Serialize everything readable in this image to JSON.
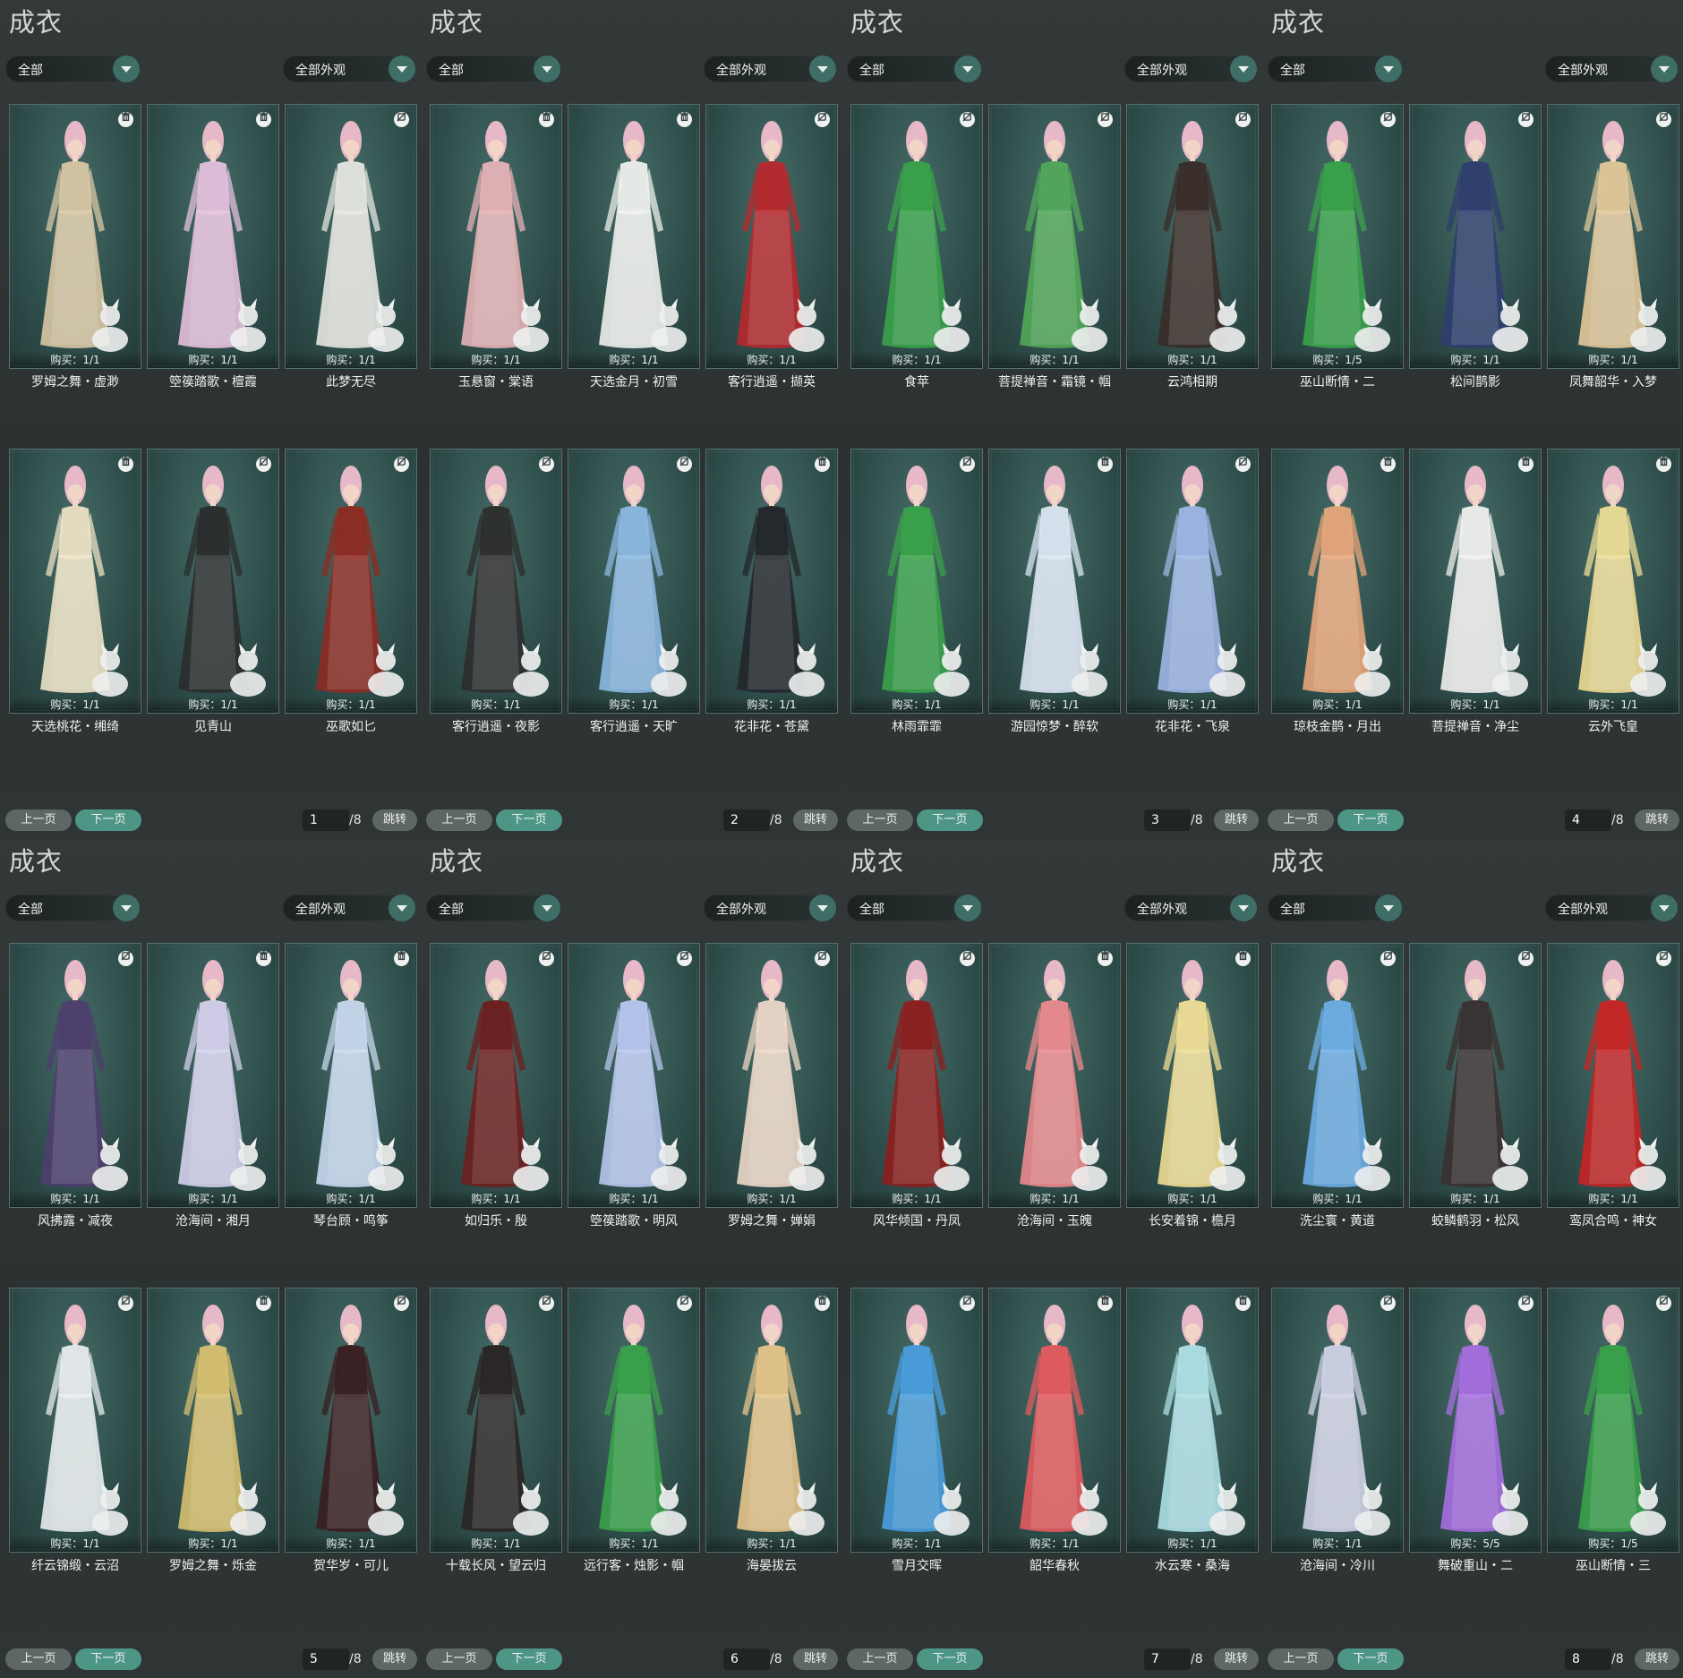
{
  "panels": [
    {
      "title": "成衣",
      "category": "全部",
      "look_filter": "全部外观",
      "page": "1",
      "total": "/8",
      "prev_label": "上一页",
      "next_label": "下一页",
      "jump_label": "跳转",
      "items": [
        {
          "name": "罗姆之舞・虚渺",
          "buy": "购买：1/1",
          "icon": "trash-icon",
          "color": "#d8c7a4"
        },
        {
          "name": "箜篌踏歌・檀霞",
          "buy": "购买：1/1",
          "icon": "trash-icon",
          "color": "#e4c0dc"
        },
        {
          "name": "此梦无尽",
          "buy": "购买：1/1",
          "icon": "hide-icon",
          "color": "#e6e6e0"
        },
        {
          "name": "天选桃花・缃绮",
          "buy": "购买：1/1",
          "icon": "trash-icon",
          "color": "#ece2c4"
        },
        {
          "name": "见青山",
          "buy": "购买：1/1",
          "icon": "hide-icon",
          "color": "#2a2c2c"
        },
        {
          "name": "巫歌如匕",
          "buy": "购买：1/1",
          "icon": "hide-icon",
          "color": "#8e2a22"
        }
      ]
    },
    {
      "title": "成衣",
      "category": "全部",
      "look_filter": "全部外观",
      "page": "2",
      "total": "/8",
      "prev_label": "上一页",
      "next_label": "下一页",
      "jump_label": "跳转",
      "items": [
        {
          "name": "玉悬窗・棠语",
          "buy": "购买：1/1",
          "icon": "trash-icon",
          "color": "#e6b2b6"
        },
        {
          "name": "天选金月・初雪",
          "buy": "购买：1/1",
          "icon": "trash-icon",
          "color": "#eef0ec"
        },
        {
          "name": "客行逍遥・撷英",
          "buy": "购买：1/1",
          "icon": "hide-icon",
          "color": "#b7282c"
        },
        {
          "name": "客行逍遥・夜影",
          "buy": "购买：1/1",
          "icon": "hide-icon",
          "color": "#2e2e2e"
        },
        {
          "name": "客行逍遥・天旷",
          "buy": "购买：1/1",
          "icon": "hide-icon",
          "color": "#8cb8e2"
        },
        {
          "name": "花非花・苍黛",
          "buy": "购买：1/1",
          "icon": "trash-icon",
          "color": "#22262a"
        }
      ]
    },
    {
      "title": "成衣",
      "category": "全部",
      "look_filter": "全部外观",
      "page": "3",
      "total": "/8",
      "prev_label": "上一页",
      "next_label": "下一页",
      "jump_label": "跳转",
      "items": [
        {
          "name": "食苹",
          "buy": "购买：1/1",
          "icon": "hide-icon",
          "color": "#3aa24a"
        },
        {
          "name": "菩提禅音・霜镜・帼",
          "buy": "购买：1/1",
          "icon": "hide-icon",
          "color": "#52a858"
        },
        {
          "name": "云鸿相期",
          "buy": "购买：1/1",
          "icon": "hide-icon",
          "color": "#3a2c28"
        },
        {
          "name": "林雨霏霏",
          "buy": "购买：1/1",
          "icon": "hide-icon",
          "color": "#3aa24a"
        },
        {
          "name": "游园惊梦・醉软",
          "buy": "购买：1/1",
          "icon": "trash-icon",
          "color": "#dbe6f2"
        },
        {
          "name": "花非花・飞泉",
          "buy": "购买：1/1",
          "icon": "hide-icon",
          "color": "#9fb6e6"
        }
      ]
    },
    {
      "title": "成衣",
      "category": "全部",
      "look_filter": "全部外观",
      "page": "4",
      "total": "/8",
      "prev_label": "上一页",
      "next_label": "下一页",
      "jump_label": "跳转",
      "items": [
        {
          "name": "巫山断情・二",
          "buy": "购买：1/5",
          "icon": "hide-icon",
          "color": "#3aa24a"
        },
        {
          "name": "松间鹊影",
          "buy": "购买：1/1",
          "icon": "hide-icon",
          "color": "#2e3e6e"
        },
        {
          "name": "凤舞韶华・入梦",
          "buy": "购买：1/1",
          "icon": "hide-icon",
          "color": "#e2c89a"
        },
        {
          "name": "琼枝金鹊・月出",
          "buy": "购买：1/1",
          "icon": "trash-icon",
          "color": "#e8a67a"
        },
        {
          "name": "菩提禅音・净尘",
          "buy": "购买：1/1",
          "icon": "trash-icon",
          "color": "#f0f0ee"
        },
        {
          "name": "云外飞皇",
          "buy": "购买：1/1",
          "icon": "trash-icon",
          "color": "#eddc96"
        }
      ]
    },
    {
      "title": "成衣",
      "category": "全部",
      "look_filter": "全部外观",
      "page": "5",
      "total": "/8",
      "prev_label": "上一页",
      "next_label": "下一页",
      "jump_label": "跳转",
      "items": [
        {
          "name": "风拂露・减夜",
          "buy": "购买：1/1",
          "icon": "hide-icon",
          "color": "#4e3e6e"
        },
        {
          "name": "沧海间・湘月",
          "buy": "购买：1/1",
          "icon": "trash-icon",
          "color": "#d4d0ec"
        },
        {
          "name": "琴台顾・鸣筝",
          "buy": "购买：1/1",
          "icon": "trash-icon",
          "color": "#c8d8ee"
        },
        {
          "name": "纤云锦缎・云沼",
          "buy": "购买：1/1",
          "icon": "hide-icon",
          "color": "#e8ecee"
        },
        {
          "name": "罗姆之舞・烁金",
          "buy": "购买：1/1",
          "icon": "trash-icon",
          "color": "#d8c070"
        },
        {
          "name": "贺华岁・可儿",
          "buy": "购买：1/1",
          "icon": "hide-icon",
          "color": "#3a1e20"
        }
      ]
    },
    {
      "title": "成衣",
      "category": "全部",
      "look_filter": "全部外观",
      "page": "6",
      "total": "/8",
      "prev_label": "上一页",
      "next_label": "下一页",
      "jump_label": "跳转",
      "items": [
        {
          "name": "如归乐・殷",
          "buy": "购买：1/1",
          "icon": "hide-icon",
          "color": "#6e1e1e"
        },
        {
          "name": "箜篌踏歌・明风",
          "buy": "购买：1/1",
          "icon": "hide-icon",
          "color": "#b8c6ee"
        },
        {
          "name": "罗姆之舞・婵娟",
          "buy": "购买：1/1",
          "icon": "hide-icon",
          "color": "#ecd8c8"
        },
        {
          "name": "十载长风・望云归",
          "buy": "购买：1/1",
          "icon": "hide-icon",
          "color": "#2a2424"
        },
        {
          "name": "远行客・烛影・帼",
          "buy": "购买：1/1",
          "icon": "hide-icon",
          "color": "#3aa24a"
        },
        {
          "name": "海晏拔云",
          "buy": "购买：1/1",
          "icon": "trash-icon",
          "color": "#e6c48a"
        }
      ]
    },
    {
      "title": "成衣",
      "category": "全部",
      "look_filter": "全部外观",
      "page": "7",
      "total": "/8",
      "prev_label": "上一页",
      "next_label": "下一页",
      "jump_label": "跳转",
      "items": [
        {
          "name": "风华倾国・丹凤",
          "buy": "购买：1/1",
          "icon": "hide-icon",
          "color": "#8e1e1e"
        },
        {
          "name": "沧海间・玉魄",
          "buy": "购买：1/1",
          "icon": "trash-icon",
          "color": "#ec8a8e"
        },
        {
          "name": "长安着锦・檐月",
          "buy": "购买：1/1",
          "icon": "trash-icon",
          "color": "#f0de96"
        },
        {
          "name": "雪月交晖",
          "buy": "购买：1/1",
          "icon": "hide-icon",
          "color": "#4a9ede"
        },
        {
          "name": "韶华春秋",
          "buy": "购买：1/1",
          "icon": "trash-icon",
          "color": "#e65a5e"
        },
        {
          "name": "水云寒・桑海",
          "buy": "购买：1/1",
          "icon": "trash-icon",
          "color": "#aee0e6"
        }
      ]
    },
    {
      "title": "成衣",
      "category": "全部",
      "look_filter": "全部外观",
      "page": "8",
      "total": "/8",
      "prev_label": "上一页",
      "next_label": "下一页",
      "jump_label": "跳转",
      "items": [
        {
          "name": "洗尘寰・黄道",
          "buy": "购买：1/1",
          "icon": "hide-icon",
          "color": "#6eaee6"
        },
        {
          "name": "蛟鳞鹤羽・松风",
          "buy": "购买：1/1",
          "icon": "hide-icon",
          "color": "#3a3030"
        },
        {
          "name": "鸾凤合鸣・神女",
          "buy": "购买：1/1",
          "icon": "hide-icon",
          "color": "#c82424"
        },
        {
          "name": "沧海间・冷川",
          "buy": "购买：1/1",
          "icon": "hide-icon",
          "color": "#d0d2e6"
        },
        {
          "name": "舞破重山・二",
          "buy": "购买：5/5",
          "icon": "hide-icon",
          "color": "#a86ee2"
        },
        {
          "name": "巫山断情・三",
          "buy": "购买：1/5",
          "icon": "hide-icon",
          "color": "#3aa24a"
        }
      ]
    }
  ]
}
